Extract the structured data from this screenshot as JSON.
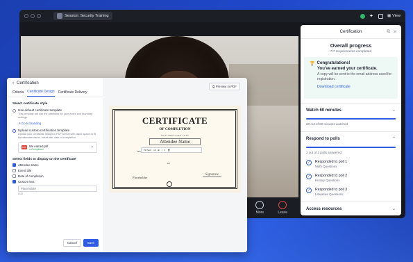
{
  "meeting": {
    "session_title": "Session: Security Training",
    "view_label": "View",
    "controls": [
      {
        "label": "More",
        "icon": "more-icon"
      },
      {
        "label": "Leave",
        "icon": "leave-icon"
      }
    ]
  },
  "panel": {
    "title": "Certification",
    "overall_title": "Overall progress",
    "overall_sub": "7/7 requirements completed",
    "congrats_title": "Congratulations!",
    "congrats_sub": "You've earned your certificate.",
    "congrats_body": "A copy will be sent to the email address used for registration.",
    "download_link": "Download certificate",
    "watch_title": "Watch 60 minutes",
    "watch_progress": 1.0,
    "watch_note": "60 out of 60 minutes watched",
    "polls_title": "Respond to polls",
    "polls_progress": 1.0,
    "polls_note": "3 out of 3 polls answered",
    "polls": [
      {
        "title": "Responded to poll 1",
        "sub": "Math Questions"
      },
      {
        "title": "Responded to poll 2",
        "sub": "History Questions"
      },
      {
        "title": "Responded to poll 3",
        "sub": "Literature Questions"
      }
    ],
    "access_title": "Access resources"
  },
  "dialog": {
    "title": "Certification",
    "tabs": [
      "Criteria",
      "Certificate Design",
      "Certificate Delivery"
    ],
    "active_tab": 1,
    "style_label": "Select certificate style",
    "opt1_title": "Use default certificate template",
    "opt1_desc": "This template will use the attributes for your event and branding settings.",
    "opt1_link": "Go to branding",
    "opt2_title": "Upload custom certification template",
    "opt2_desc": "Upload your certificate design in PDF format with blank space to fit the attendee name, event title, date of completion.",
    "file_name": "We earned.pdf",
    "file_status": "Completed",
    "fields_label": "Select fields to display on the certificate",
    "fields": [
      {
        "label": "Attendee name",
        "checked": true
      },
      {
        "label": "Event title",
        "checked": false
      },
      {
        "label": "Date of completion",
        "checked": false
      },
      {
        "label": "Custom text",
        "checked": true
      }
    ],
    "custom_text_placeholder": "Placeholder",
    "custom_text_hint": "0/40",
    "cancel_label": "Cancel",
    "save_label": "Save",
    "preview_pdf_label": "Preview in PDF",
    "certificate": {
      "title": "CERTIFICATE",
      "subtitle": "OF COMPLETION",
      "small": "THIS CERTIFIES THAT",
      "name": "Attendee Name",
      "toolbar_font": "PR Serif",
      "toolbar_size": "16",
      "left_text": "Field",
      "placeholder": "Placeholder",
      "signature": "Signature",
      "mid": "a.b"
    }
  }
}
